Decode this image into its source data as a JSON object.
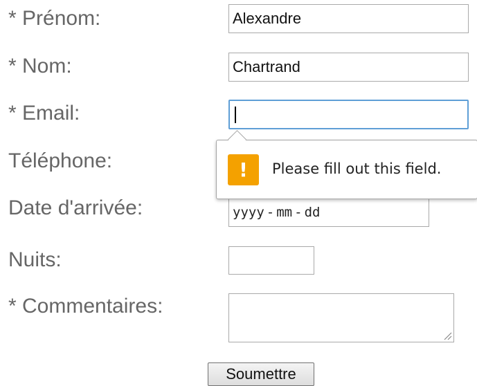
{
  "form": {
    "prenom_label": "* Prénom:",
    "prenom_value": "Alexandre",
    "nom_label": "* Nom:",
    "nom_value": "Chartrand",
    "email_label": "* Email:",
    "email_value": "",
    "telephone_label": "Téléphone:",
    "date_label": "Date d'arrivée:",
    "date_placeholder": {
      "year": "yyyy",
      "separator": "-",
      "month": "mm",
      "day": "dd"
    },
    "nuits_label": "Nuits:",
    "commentaires_label": "* Commentaires:",
    "submit_label": "Soumettre"
  },
  "validation": {
    "message": "Please fill out this field.",
    "icon": "!",
    "icon_color": "#f4a100",
    "focus_border_color": "#5e9ed6"
  }
}
